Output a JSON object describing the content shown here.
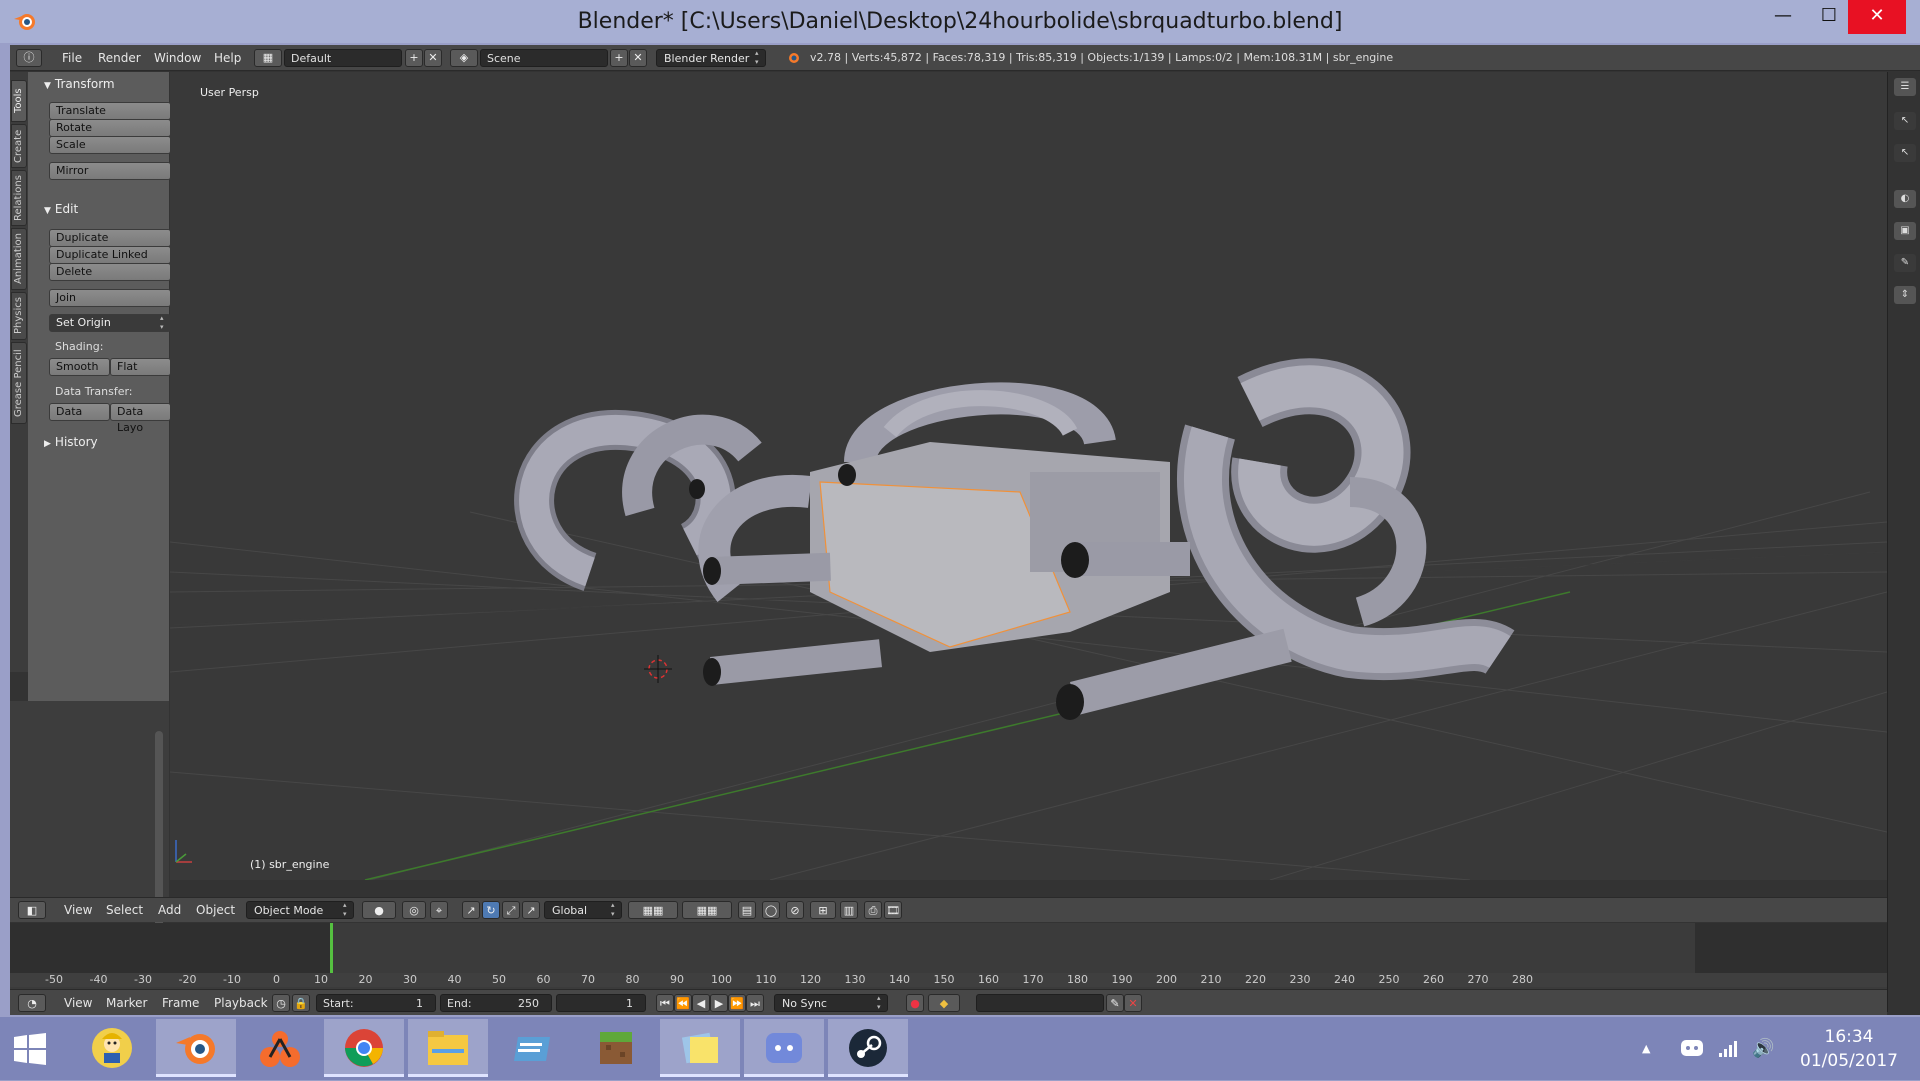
{
  "window": {
    "title": "Blender* [C:\\Users\\Daniel\\Desktop\\24hourbolide\\sbrquadturbo.blend]",
    "min_glyph": "—",
    "max_glyph": "☐",
    "close_glyph": "✕"
  },
  "infobar": {
    "menus": [
      "File",
      "Render",
      "Window",
      "Help"
    ],
    "layout": "Default",
    "scene": "Scene",
    "engine": "Blender Render",
    "stats": "v2.78 | Verts:45,872 | Faces:78,319 | Tris:85,319 | Objects:1/139 | Lamps:0/2 | Mem:108.31M | sbr_engine",
    "add_glyph": "+",
    "remove_glyph": "✕"
  },
  "tabs": [
    "Tools",
    "Create",
    "Relations",
    "Animation",
    "Physics",
    "Grease Pencil"
  ],
  "toolshelf": {
    "transform": {
      "title": "Transform",
      "translate": "Translate",
      "rotate": "Rotate",
      "scale": "Scale",
      "mirror": "Mirror"
    },
    "edit": {
      "title": "Edit",
      "duplicate": "Duplicate",
      "duplicate_linked": "Duplicate Linked",
      "delete": "Delete",
      "join": "Join",
      "set_origin": "Set Origin",
      "shading_label": "Shading:",
      "smooth": "Smooth",
      "flat": "Flat",
      "data_transfer_label": "Data Transfer:",
      "data": "Data",
      "data_layo": "Data Layo"
    },
    "history": {
      "title": "History"
    }
  },
  "viewport": {
    "view_name": "User Persp",
    "object_label": "(1) sbr_engine",
    "colors": {
      "background": "#393939",
      "grid": "#464646",
      "x_axis": "#8a3c3c",
      "y_axis": "#3a7a2a",
      "mesh": "#a6a6b0",
      "selection": "#f0913a"
    }
  },
  "header3d": {
    "menus": [
      "View",
      "Select",
      "Add",
      "Object"
    ],
    "mode": "Object Mode",
    "orientation": "Global"
  },
  "timeline": {
    "ruler": [
      "-50",
      "-40",
      "-30",
      "-20",
      "-10",
      "0",
      "10",
      "20",
      "30",
      "40",
      "50",
      "60",
      "70",
      "80",
      "90",
      "100",
      "110",
      "120",
      "130",
      "140",
      "150",
      "160",
      "170",
      "180",
      "190",
      "200",
      "210",
      "220",
      "230",
      "240",
      "250",
      "260",
      "270",
      "280"
    ],
    "menus": [
      "View",
      "Marker",
      "Frame",
      "Playback"
    ],
    "start_label": "Start:",
    "start_value": "1",
    "end_label": "End:",
    "end_value": "250",
    "current_frame": "1",
    "sync": "No Sync"
  },
  "taskbar": {
    "time": "16:34",
    "date": "01/05/2017",
    "apps": [
      "Fallout Shelter",
      "Blender",
      "Origin",
      "Google Chrome",
      "File Explorer",
      "Unknown App",
      "Minecraft",
      "Sticky Notes",
      "Discord",
      "Steam"
    ],
    "tray_up_glyph": "▲",
    "volume_glyph": "🔊"
  }
}
